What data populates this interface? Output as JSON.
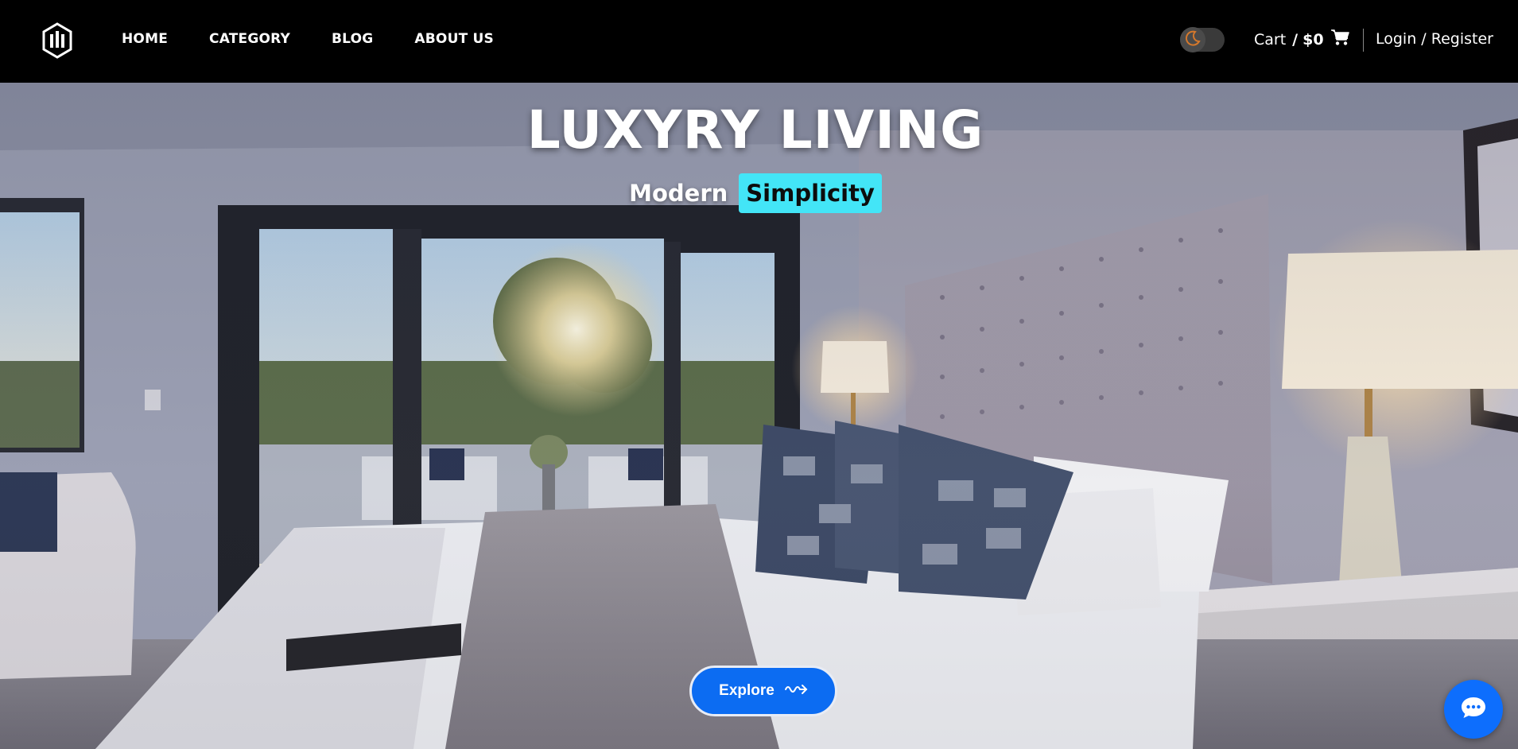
{
  "nav": {
    "links": [
      "HOME",
      "CATEGORY",
      "BLOG",
      "ABOUT US"
    ],
    "cart_label": "Cart",
    "cart_separator": "/",
    "cart_amount": "$0",
    "login_label": "Login / Register",
    "icons": [
      "brand-logo-icon",
      "moon-icon",
      "shopping-cart-icon"
    ]
  },
  "hero": {
    "title": "LUXYRY LIVING",
    "subtitle_word": "Modern",
    "subtitle_highlight": "Simplicity",
    "explore_label": "Explore",
    "highlight_color": "#43e5f7"
  },
  "chat": {
    "icon": "chat-bubble-icon",
    "color": "#0d6efd"
  }
}
